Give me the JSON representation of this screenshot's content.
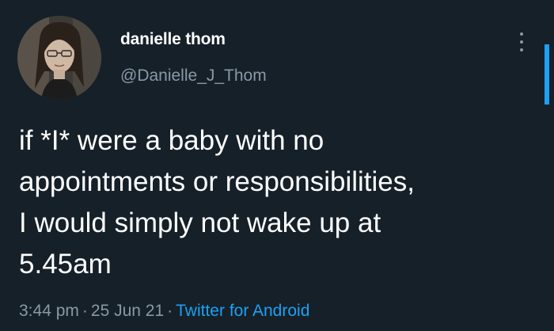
{
  "tweet": {
    "author": {
      "display_name": "danielle thom",
      "handle": "@Danielle_J_Thom",
      "avatar": "profile-photo"
    },
    "more_icon": "more-vertical-icon",
    "text_lines": [
      "if *I* were a baby with no",
      "appointments or responsibilities,",
      "I would simply not wake up at",
      "5.45am"
    ],
    "time": "3:44 pm",
    "separator": "·",
    "date": "25 Jun 21",
    "source": "Twitter for Android"
  },
  "colors": {
    "background": "#162029",
    "primary_text": "#ffffff",
    "secondary_text": "#8899a6",
    "accent": "#1da1f2"
  }
}
